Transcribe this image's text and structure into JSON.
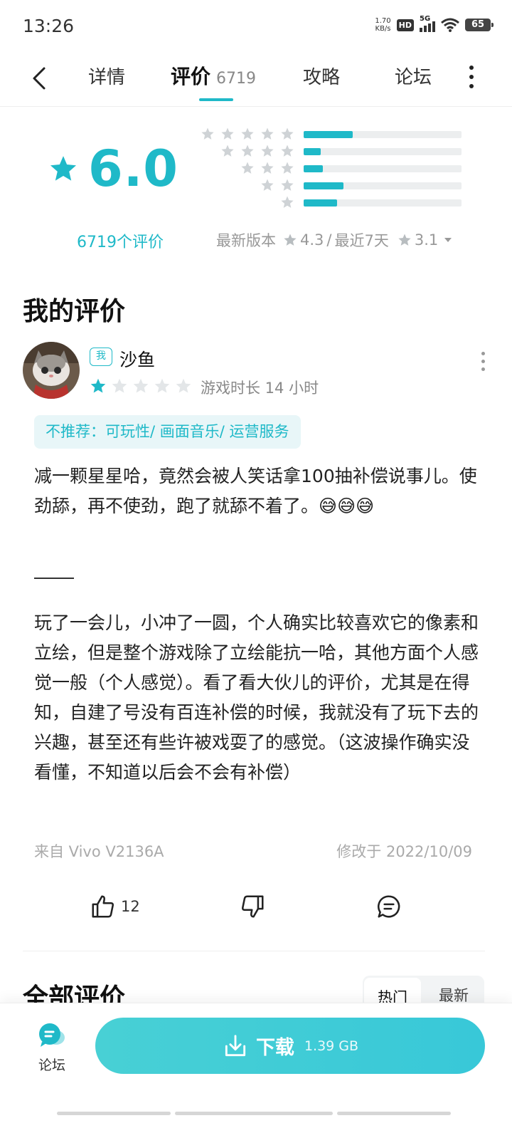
{
  "status_bar": {
    "time": "13:26",
    "net_speed_value": "1.70",
    "net_speed_unit": "KB/s",
    "hd": "HD",
    "network": "5G",
    "battery": "65"
  },
  "nav": {
    "tabs": [
      {
        "label": "详情"
      },
      {
        "label": "评价",
        "count": "6719",
        "active": true
      },
      {
        "label": "攻略"
      },
      {
        "label": "论坛"
      }
    ]
  },
  "rating": {
    "score": "6.0",
    "total_label": "6719个评价",
    "distribution": [
      {
        "stars": 5,
        "fraction": 0.31
      },
      {
        "stars": 4,
        "fraction": 0.11
      },
      {
        "stars": 3,
        "fraction": 0.12
      },
      {
        "stars": 2,
        "fraction": 0.25
      },
      {
        "stars": 1,
        "fraction": 0.21
      }
    ],
    "latest_version_label": "最新版本",
    "latest_version_score": "4.3",
    "separator": "/",
    "recent_label": "最近7天",
    "recent_score": "3.1"
  },
  "my_review": {
    "section_title": "我的评价",
    "me_badge": "我",
    "username": "沙鱼",
    "stars": 1,
    "playtime": "游戏时长 14 小时",
    "tag_line": "不推荐：可玩性/ 画面音乐/ 运营服务",
    "paragraph1": "减一颗星星哈，竟然会被人笑话拿100抽补偿说事儿。使劲舔，再不使劲，跑了就舔不着了。😅😅😅",
    "paragraph2": "玩了一会儿，小冲了一圆，个人确实比较喜欢它的像素和立绘，但是整个游戏除了立绘能抗一哈，其他方面个人感觉一般（个人感觉）。看了看大伙儿的评价，尤其是在得知，自建了号没有百连补偿的时候，我就没有了玩下去的兴趣，甚至还有些许被戏耍了的感觉。（这波操作确实没看懂，不知道以后会不会有补偿）",
    "device": "来自 Vivo V2136A",
    "modified": "修改于 2022/10/09",
    "likes": "12"
  },
  "all_reviews": {
    "section_title": "全部评价",
    "sort_options": [
      "热门",
      "最新"
    ]
  },
  "bottom_bar": {
    "forum_label": "论坛",
    "download_label": "下载",
    "download_size": "1.39 GB"
  },
  "colors": {
    "accent": "#1fb9c8",
    "star_gray": "#cfd3d6",
    "tag_bg": "#e8f6f8"
  }
}
